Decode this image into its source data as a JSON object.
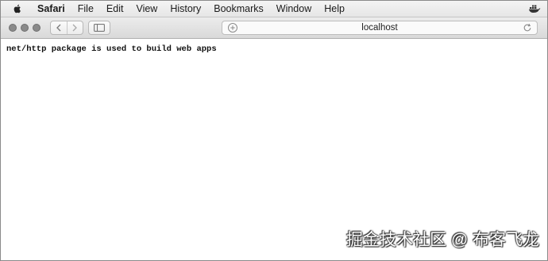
{
  "menubar": {
    "app_name": "Safari",
    "items": [
      "File",
      "Edit",
      "View",
      "History",
      "Bookmarks",
      "Window",
      "Help"
    ]
  },
  "toolbar": {
    "address": "localhost"
  },
  "page": {
    "text": "net/http package is used to build web apps"
  },
  "watermark": "掘金技术社区 @ 布客飞龙",
  "icons": {
    "apple": "apple-icon",
    "back": "chevron-left-icon",
    "forward": "chevron-right-icon",
    "sidebar": "sidebar-icon",
    "add": "plus-circle-icon",
    "reload": "reload-icon",
    "menu_extra": "docker-icon"
  }
}
